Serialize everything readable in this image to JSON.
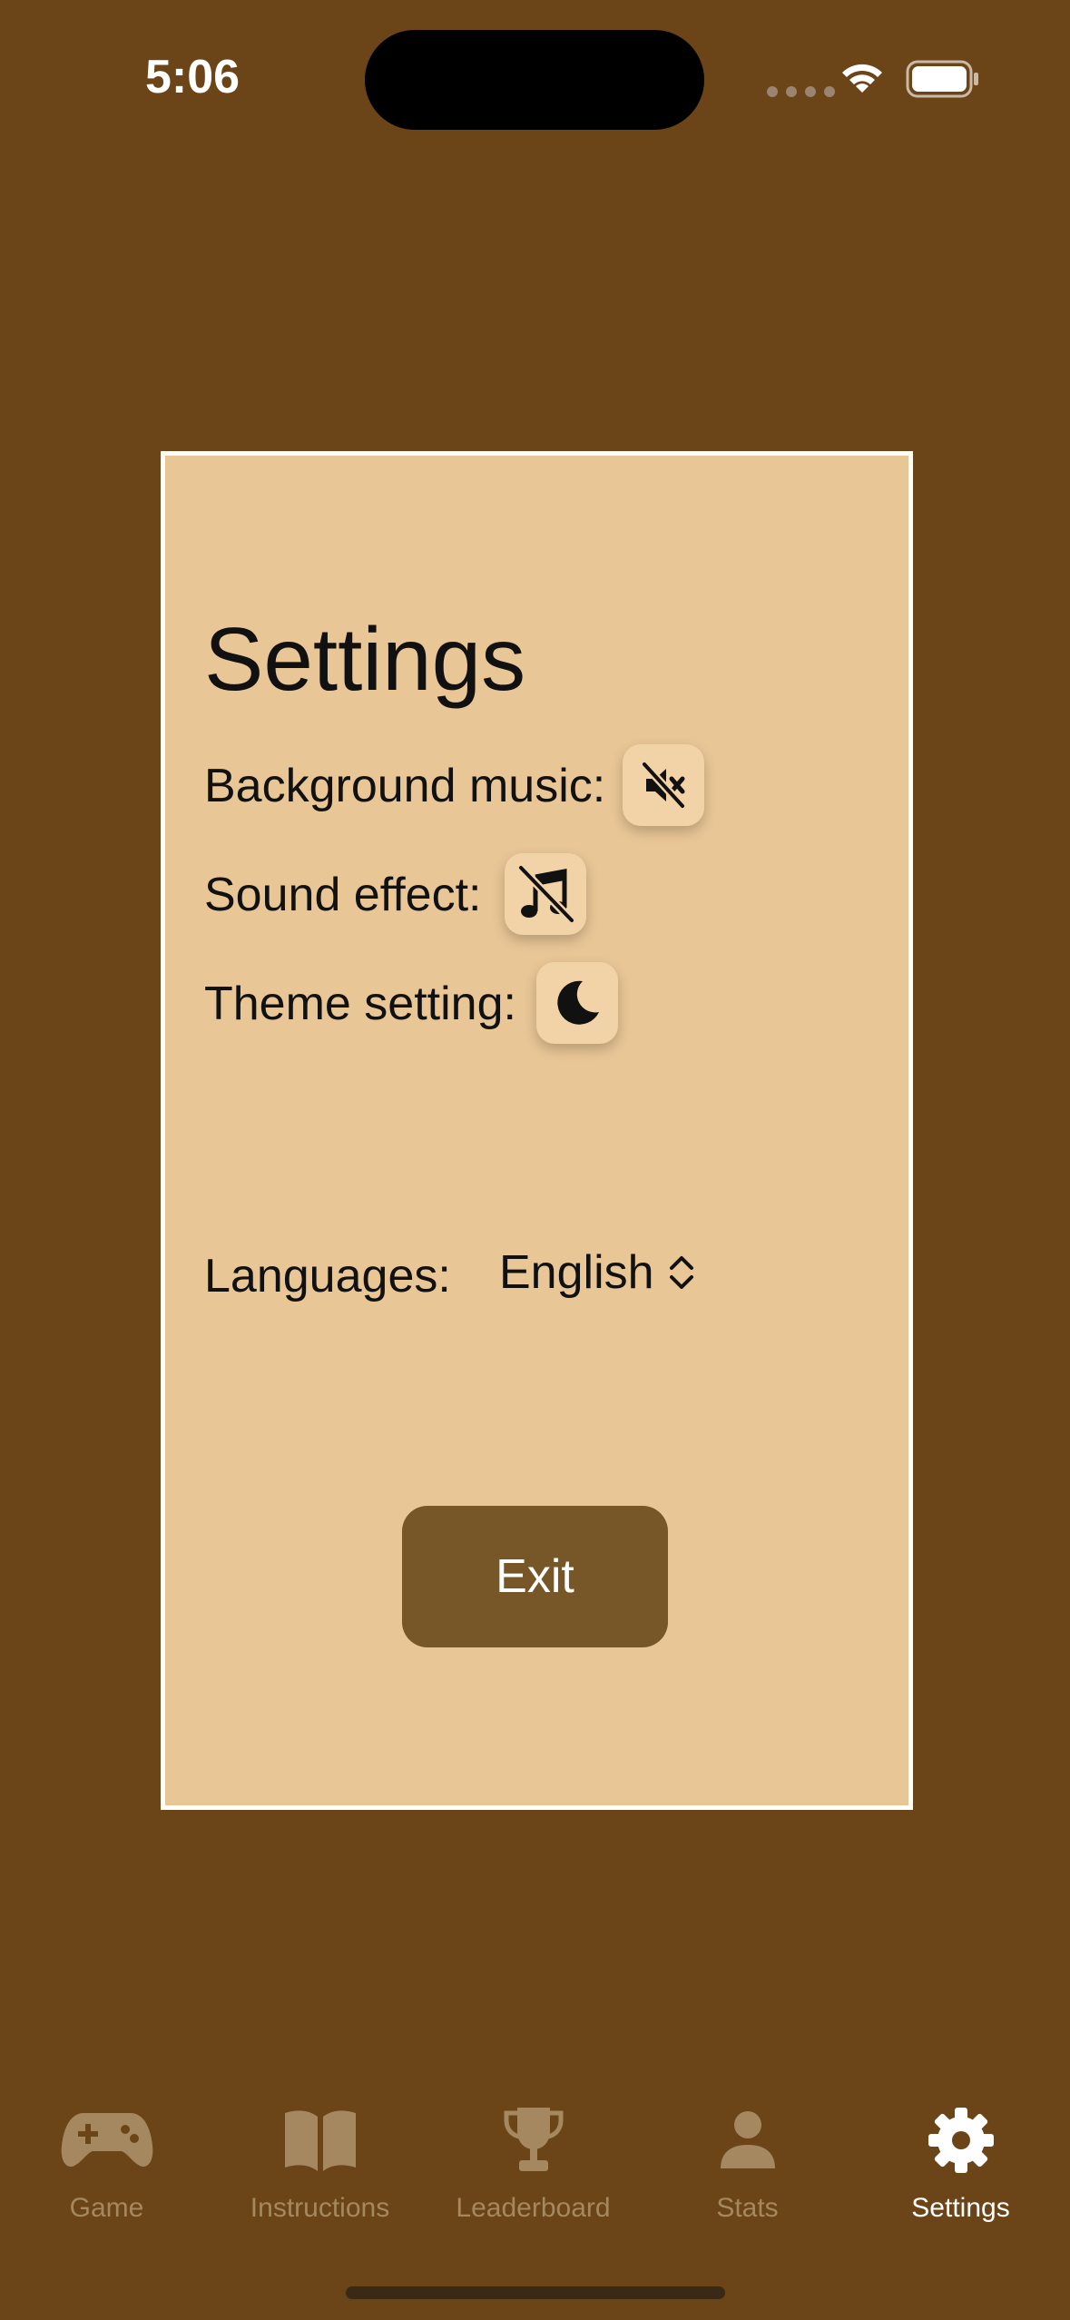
{
  "status_bar": {
    "time": "5:06"
  },
  "settings": {
    "title": "Settings",
    "rows": [
      {
        "label": "Background music:",
        "icon": "speaker-muted-icon"
      },
      {
        "label": "Sound effect:",
        "icon": "music-note-slash-icon"
      },
      {
        "label": "Theme setting:",
        "icon": "moon-icon"
      }
    ],
    "languages": {
      "label": "Languages:",
      "selected": "English"
    },
    "exit_label": "Exit"
  },
  "tab_bar": {
    "active": "Settings",
    "items": [
      {
        "label": "Game",
        "icon": "gamecontroller-icon"
      },
      {
        "label": "Instructions",
        "icon": "book-icon"
      },
      {
        "label": "Leaderboard",
        "icon": "trophy-icon"
      },
      {
        "label": "Stats",
        "icon": "person-icon"
      },
      {
        "label": "Settings",
        "icon": "gear-icon"
      }
    ]
  },
  "colors": {
    "background": "#6b4418",
    "card": "#e9c696",
    "exit_button": "#775627",
    "tab_inactive": "#a5885f",
    "tab_active": "#ffffff"
  }
}
